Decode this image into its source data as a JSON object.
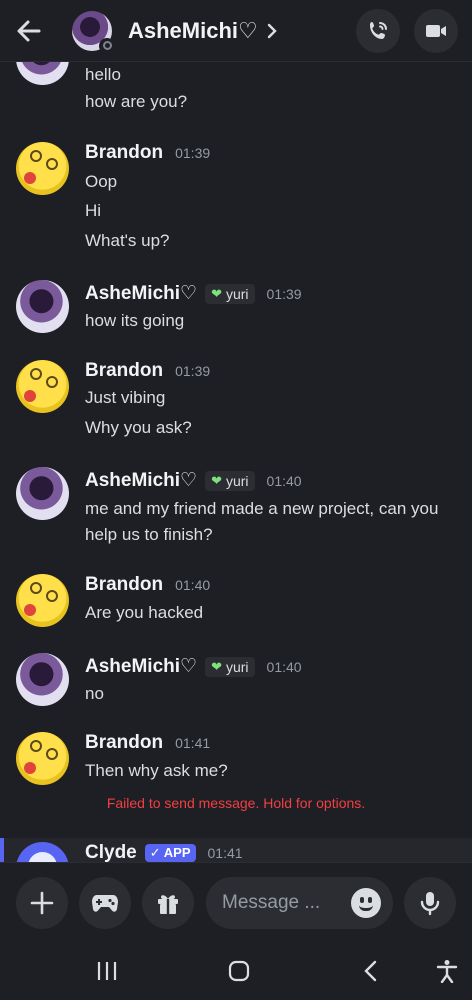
{
  "header": {
    "title": "AsheMichi♡",
    "icons": {
      "back": "arrow-left-icon",
      "chevron": "chevron-right-icon",
      "call": "phone-call-icon",
      "video": "video-camera-icon"
    }
  },
  "messages": [
    {
      "user": "",
      "lines": [
        "hello",
        "how are you?"
      ]
    },
    {
      "user": "Brandon",
      "time": "01:39",
      "lines": [
        "Oop",
        "Hi",
        "What's up?"
      ]
    },
    {
      "user": "AsheMichi♡",
      "tag": "yuri",
      "time": "01:39",
      "lines": [
        "how its going"
      ]
    },
    {
      "user": "Brandon",
      "time": "01:39",
      "lines": [
        "Just vibing",
        "Why you ask?"
      ]
    },
    {
      "user": "AsheMichi♡",
      "tag": "yuri",
      "time": "01:40",
      "lines": [
        "me and my friend made a new project, can you",
        "help us to finish?"
      ]
    },
    {
      "user": "Brandon",
      "time": "01:40",
      "lines": [
        "Are you hacked"
      ]
    },
    {
      "user": "AsheMichi♡",
      "tag": "yuri",
      "time": "01:40",
      "lines": [
        "no"
      ]
    },
    {
      "user": "Brandon",
      "time": "01:41",
      "lines": [
        "Then why ask me?"
      ]
    }
  ],
  "failed_notice": "Failed to send message. Hold for options.",
  "clyde": {
    "name": "Clyde",
    "badge": "✓ APP",
    "time": "01:41"
  },
  "composer": {
    "placeholder": "Message ..."
  },
  "colors": {
    "background": "#1e1f24",
    "accent": "#5865f2",
    "error": "#f23f42",
    "tag_heart": "#7ee27a"
  }
}
